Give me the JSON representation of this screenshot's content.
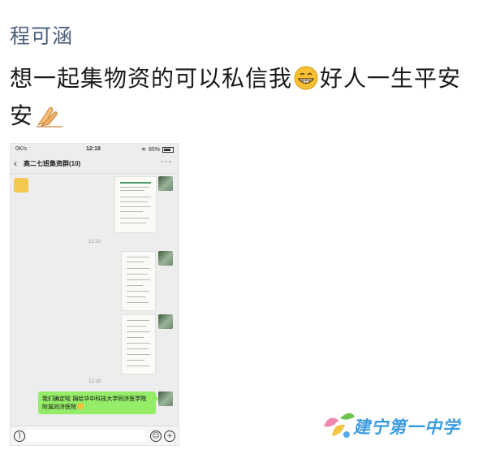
{
  "post": {
    "author": "程可涵",
    "text_part1": "想一起集物资的可以私信我",
    "text_part2": "好人一生平安"
  },
  "emoji": {
    "grin": "grinning-face-icon",
    "pray": "folded-hands-icon"
  },
  "phone_screenshot": {
    "status": {
      "speed": "0K/s",
      "time": "12:18",
      "battery": "85%"
    },
    "chat_title": "高二七班集资群(10)",
    "timestamps": [
      "12:10",
      "12:18"
    ],
    "message": "我们确定啦 捐给华中科技大学同济医学院附属同济医院"
  },
  "watermark": {
    "text": "建宁第一中学"
  },
  "colors": {
    "author": "#4b5f7d",
    "bubble": "#95ec69",
    "watermark": "#3b9be0"
  }
}
